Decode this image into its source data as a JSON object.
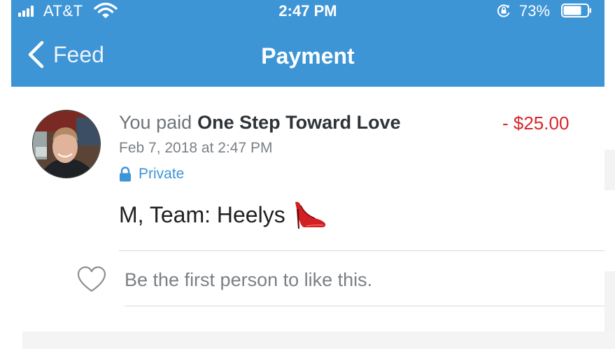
{
  "status_bar": {
    "carrier": "AT&T",
    "time": "2:47 PM",
    "battery_percent": "73%",
    "icons": [
      "signal-icon",
      "wifi-icon",
      "rotation-lock-icon",
      "battery-icon"
    ]
  },
  "nav": {
    "back_label": "Feed",
    "title": "Payment",
    "bar_color": "#3d95d6"
  },
  "transaction": {
    "prefix": "You paid",
    "recipient": "One Step Toward Love",
    "amount": "- $25.00",
    "amount_color": "#d9262c",
    "date": "Feb 7, 2018 at 2:47 PM",
    "privacy": "Private",
    "note": "M, Team: Heelys",
    "note_emoji": "high-heel-shoe"
  },
  "social": {
    "like_prompt": "Be the first person to like this."
  }
}
